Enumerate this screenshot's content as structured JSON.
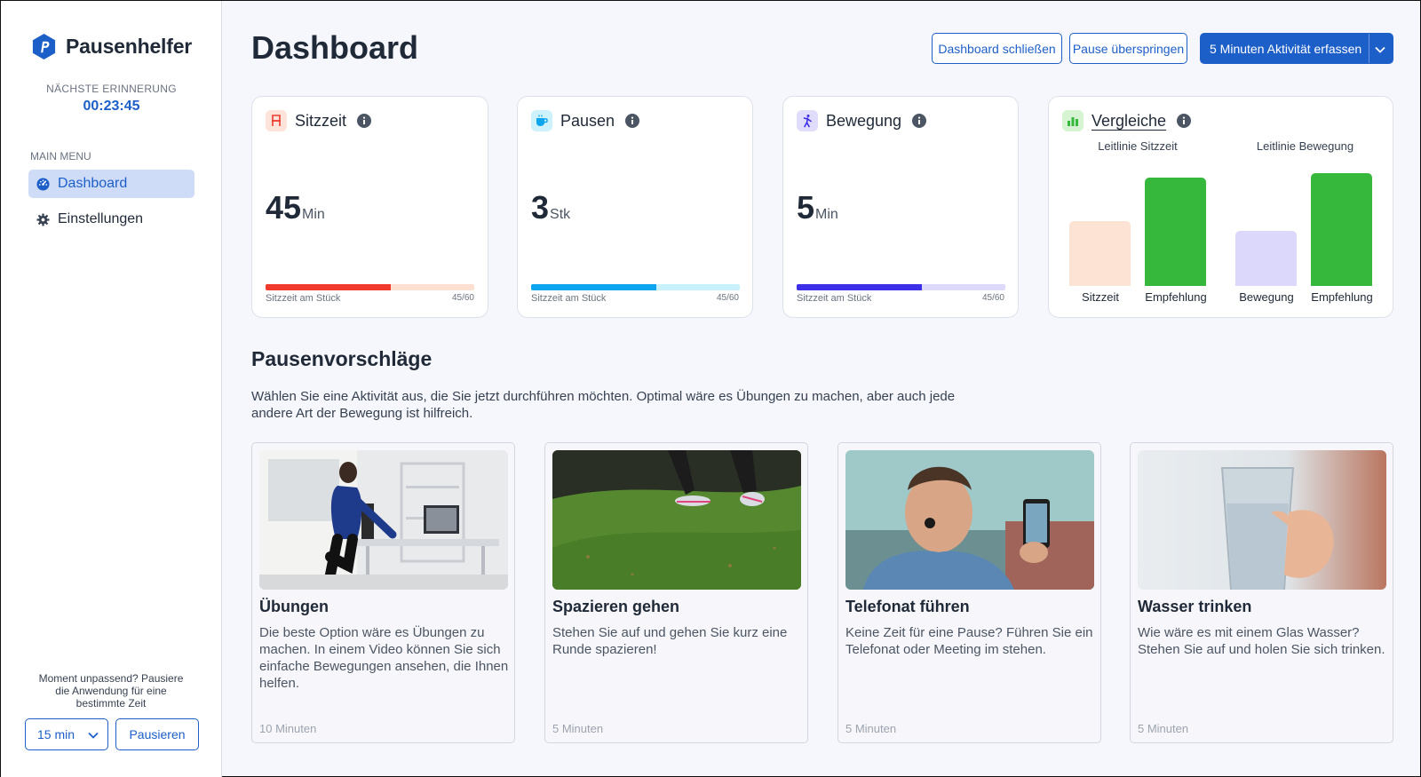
{
  "app": {
    "name": "Pausenhelfer"
  },
  "sidebar": {
    "next_reminder_label": "NÄCHSTE ERINNERUNG",
    "next_reminder_time": "00:23:45",
    "menu_label": "MAIN MENU",
    "items": [
      {
        "label": "Dashboard",
        "icon": "dashboard-icon",
        "active": true
      },
      {
        "label": "Einstellungen",
        "icon": "gear-icon",
        "active": false
      }
    ],
    "pause_note": "Moment unpassend? Pausiere die Anwendung für eine bestimmte Zeit",
    "pause_duration": "15 min",
    "pause_button": "Pausieren"
  },
  "header": {
    "title": "Dashboard",
    "close_button": "Dashboard schließen",
    "skip_button": "Pause überspringen",
    "primary_button": "5 Minuten Aktivität erfassen"
  },
  "stats": [
    {
      "title": "Sitzzeit",
      "icon": "chair-icon",
      "value": "45",
      "unit": "Min",
      "caption": "Sitzzeit am Stück",
      "ratio": "45/60",
      "progress": 0.6,
      "color": "#f03a2e",
      "track": "#fde0d2",
      "icon_bg": "#fde3da"
    },
    {
      "title": "Pausen",
      "icon": "coffee-cup-icon",
      "value": "3",
      "unit": "Stk",
      "caption": "Sitzzeit am Stück",
      "ratio": "45/60",
      "progress": 0.6,
      "color": "#0ea5f0",
      "track": "#c8f1fb",
      "icon_bg": "#cdf2fb"
    },
    {
      "title": "Bewegung",
      "icon": "person-moving-icon",
      "value": "5",
      "unit": "Min",
      "caption": "Sitzzeit am Stück",
      "ratio": "45/60",
      "progress": 0.6,
      "color": "#3d2ee8",
      "track": "#ddd9fb",
      "icon_bg": "#e0dcfb"
    }
  ],
  "comparison": {
    "title": "Vergleiche",
    "icon": "bar-chart-icon",
    "groups": [
      {
        "label": "Leitlinie Sitzzeit",
        "bars": [
          {
            "label": "Sitzzeit",
            "value": 45,
            "color": "#fde3d4"
          },
          {
            "label": "Empfehlung",
            "value": 75,
            "color": "#35b83c"
          }
        ]
      },
      {
        "label": "Leitlinie Bewegung",
        "bars": [
          {
            "label": "Bewegung",
            "value": 38,
            "color": "#dcd8fb"
          },
          {
            "label": "Empfehlung",
            "value": 78,
            "color": "#35b83c"
          }
        ]
      }
    ]
  },
  "suggestions": {
    "title": "Pausenvorschläge",
    "description": "Wählen Sie eine Aktivität aus, die Sie jetzt durchführen möchten. Optimal wäre es Übungen zu machen, aber auch jede andere Art der Bewegung ist hilfreich.",
    "items": [
      {
        "title": "Übungen",
        "description": "Die beste Option wäre es Übungen zu machen. In einem Video können Sie sich einfache Bewegungen ansehen, die Ihnen helfen.",
        "duration": "10 Minuten",
        "image": "office-stretching-image"
      },
      {
        "title": "Spazieren gehen",
        "description": "Stehen Sie auf und gehen Sie kurz eine Runde spazieren!",
        "duration": "5 Minuten",
        "image": "walking-on-grass-image"
      },
      {
        "title": "Telefonat führen",
        "description": "Keine Zeit für eine Pause? Führen Sie ein Telefonat oder Meeting im stehen.",
        "duration": "5 Minuten",
        "image": "video-call-image"
      },
      {
        "title": "Wasser trinken",
        "description": "Wie wäre es mit einem Glas Wasser? Stehen Sie auf und holen Sie sich trinken.",
        "duration": "5 Minuten",
        "image": "glass-of-water-image"
      }
    ]
  },
  "colors": {
    "accent": "#1d5fc9",
    "background": "#f5f7fc"
  }
}
